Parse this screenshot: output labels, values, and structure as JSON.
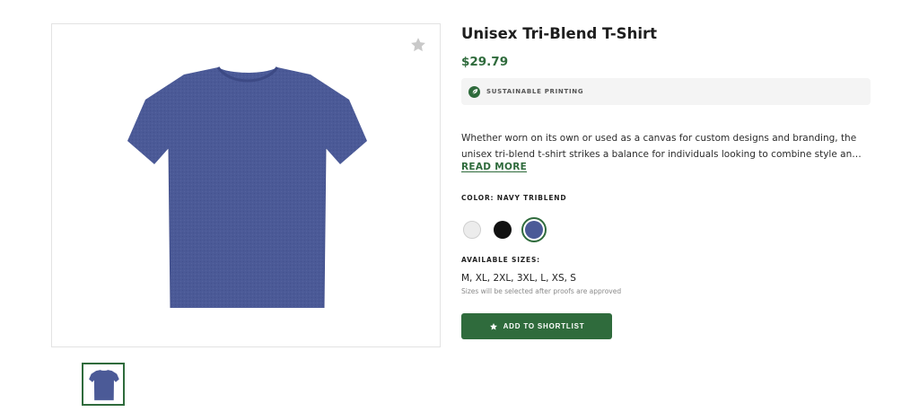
{
  "product": {
    "title": "Unisex Tri-Blend T-Shirt",
    "price": "$29.79",
    "badge": "SUSTAINABLE PRINTING",
    "description_lines": [
      "Whether worn on its own or used as a canvas for custom designs and branding, the",
      "unisex tri-blend t-shirt strikes a balance for individuals looking to combine style an…"
    ],
    "read_more": "READ MORE",
    "color_label": "COLOR: NAVY TRIBLEND",
    "swatches": [
      {
        "name": "white",
        "color": "#ececec"
      },
      {
        "name": "black",
        "color": "#111111"
      },
      {
        "name": "navy triblend",
        "color": "#4b5a97",
        "selected": true
      }
    ],
    "sizes_label": "AVAILABLE SIZES:",
    "sizes": "M, XL, 2XL, 3XL, L, XS, S",
    "sizes_note": "Sizes will be selected after proofs are approved",
    "add_button": "ADD TO SHORTLIST"
  },
  "icons": {
    "favorite": "star-icon",
    "badge": "leaf-icon",
    "button": "star-icon"
  },
  "colors": {
    "accent": "#2f6b3c",
    "shirt": "#4b5a97"
  }
}
